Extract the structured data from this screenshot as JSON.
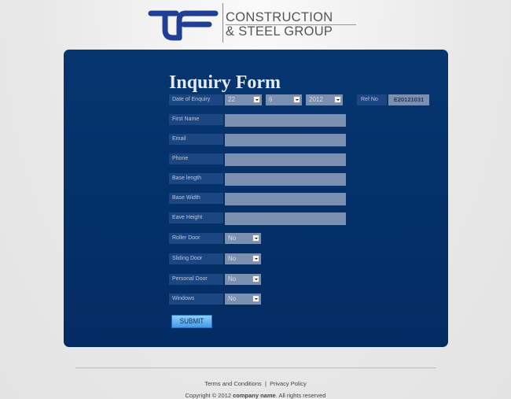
{
  "logo": {
    "line1": "CONSTRUCTION",
    "line2": "& STEEL GROUP",
    "brand_color": "#1e3f94"
  },
  "form": {
    "title": "Inquiry Form",
    "date": {
      "label": "Date of Enquiry",
      "day": "22",
      "month": "6",
      "year": "2012"
    },
    "ref": {
      "label": "Ref No",
      "value": "E20121031"
    },
    "text_fields": [
      {
        "label": "First Name",
        "value": ""
      },
      {
        "label": "Email",
        "value": ""
      },
      {
        "label": "Phone",
        "value": ""
      },
      {
        "label": "Base length",
        "value": ""
      },
      {
        "label": "Base Width",
        "value": ""
      },
      {
        "label": "Eave Height",
        "value": ""
      }
    ],
    "select_fields": [
      {
        "label": "Roller Door",
        "value": "No"
      },
      {
        "label": "Sliding Door",
        "value": "No"
      },
      {
        "label": "Personal Door",
        "value": "No"
      },
      {
        "label": "Windows",
        "value": "No"
      }
    ],
    "submit": "SUBMIT"
  },
  "footer": {
    "terms": "Terms and Conditions",
    "sep": "|",
    "privacy": "Privacy Policy",
    "copy_pre": "Copyright © 2012 ",
    "company": "company name",
    "copy_post": ". All rights reserved"
  }
}
